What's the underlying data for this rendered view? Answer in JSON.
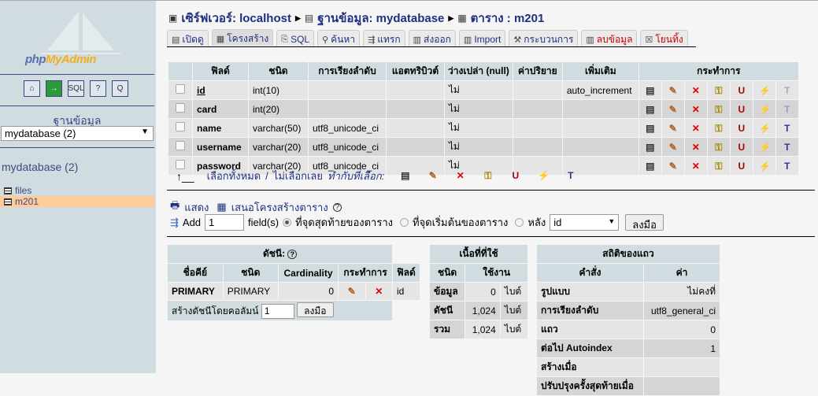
{
  "sidebar": {
    "logo": "phpMyAdmin",
    "quick_icons": [
      "home-icon",
      "exit-icon",
      "sql-query-icon",
      "help-icon",
      "sql-docs-icon"
    ],
    "db_label": "ฐานข้อมูล",
    "db_select": "mydatabase (2)",
    "db_name": "mydatabase (2)",
    "tables": [
      {
        "name": "files",
        "selected": false
      },
      {
        "name": "m201",
        "selected": true
      }
    ]
  },
  "breadcrumb": {
    "server": "เซิร์ฟเวอร์: localhost",
    "database": "ฐานข้อมูล: mydatabase",
    "table": "ตาราง : m201"
  },
  "tabs": [
    {
      "label": "เปิดดู",
      "icon": "▤"
    },
    {
      "label": "โครงสร้าง",
      "icon": "▦",
      "active": true
    },
    {
      "label": "SQL",
      "icon": "⎘"
    },
    {
      "label": "ค้นหา",
      "icon": "⚲"
    },
    {
      "label": "แทรก",
      "icon": "⇶"
    },
    {
      "label": "ส่งออก",
      "icon": "▥"
    },
    {
      "label": "Import",
      "icon": "▥"
    },
    {
      "label": "กระบวนการ",
      "icon": "⚒"
    },
    {
      "label": "ลบข้อมูล",
      "icon": "▥",
      "red": true
    },
    {
      "label": "โยนทิ้ง",
      "icon": "☒",
      "red": true
    }
  ],
  "structure": {
    "headers": [
      "ฟิลด์",
      "ชนิด",
      "การเรียงลำดับ",
      "แอตทริบิวต์",
      "ว่างเปล่า (null)",
      "ค่าปริยาย",
      "เพิ่มเติม",
      "กระทำการ"
    ],
    "rows": [
      {
        "field": "id",
        "type": "int(10)",
        "collation": "",
        "attributes": "",
        "null": "ไม่",
        "default": "",
        "extra": "auto_increment",
        "primary": true
      },
      {
        "field": "card",
        "type": "int(20)",
        "collation": "",
        "attributes": "",
        "null": "ไม่",
        "default": "",
        "extra": ""
      },
      {
        "field": "name",
        "type": "varchar(50)",
        "collation": "utf8_unicode_ci",
        "attributes": "",
        "null": "ไม่",
        "default": "",
        "extra": ""
      },
      {
        "field": "username",
        "type": "varchar(20)",
        "collation": "utf8_unicode_ci",
        "attributes": "",
        "null": "ไม่",
        "default": "",
        "extra": ""
      },
      {
        "field": "password",
        "type": "varchar(20)",
        "collation": "utf8_unicode_ci",
        "attributes": "",
        "null": "ไม่",
        "default": "",
        "extra": ""
      }
    ],
    "check_all": "เลือกทั้งหมด",
    "separator": "/",
    "uncheck_all": "ไม่เลือกเลย",
    "with_selected": "ทำกับที่เลือก:"
  },
  "links": {
    "print": "แสดง",
    "propose": "เสนอโครงสร้างตาราง"
  },
  "add_field": {
    "label": "Add",
    "count": "1",
    "fields": "field(s)",
    "opt_end": "ที่จุดสุดท้ายของตาราง",
    "opt_begin": "ที่จุดเริ่มต้นของตาราง",
    "opt_after": "หลัง",
    "after_value": "id",
    "go": "ลงมือ"
  },
  "indexes": {
    "title": "ดัชนี:",
    "headers": [
      "ชื่อคีย์",
      "ชนิด",
      "Cardinality",
      "กระทำการ",
      "ฟิลด์"
    ],
    "rows": [
      {
        "key": "PRIMARY",
        "type": "PRIMARY",
        "cardinality": "0",
        "field": "id"
      }
    ],
    "create_label": "สร้างดัชนีโดยคอลัมน์",
    "create_value": "1",
    "go": "ลงมือ"
  },
  "space": {
    "title": "เนื้อที่ที่ใช้",
    "headers": [
      "ชนิด",
      "ใช้งาน"
    ],
    "rows": [
      {
        "type": "ข้อมูล",
        "value": "0",
        "unit": "ไบต์"
      },
      {
        "type": "ดัชนี",
        "value": "1,024",
        "unit": "ไบต์"
      },
      {
        "type": "รวม",
        "value": "1,024",
        "unit": "ไบต์"
      }
    ]
  },
  "row_stats": {
    "title": "สถิติของแถว",
    "headers": [
      "คำสั่ง",
      "ค่า"
    ],
    "rows": [
      {
        "stmt": "รูปแบบ",
        "value": "ไม่คงที่"
      },
      {
        "stmt": "การเรียงลำดับ",
        "value": "utf8_general_ci"
      },
      {
        "stmt": "แถว",
        "value": "0"
      },
      {
        "stmt": "ต่อไป Autoindex",
        "value": "1"
      },
      {
        "stmt": "สร้างเมื่อ",
        "value": ""
      },
      {
        "stmt": "ปรับปรุงครั้งสุดท้ายเมื่อ",
        "value": ""
      }
    ]
  },
  "colors": {
    "sidebar": "#d0dce0",
    "header": "#d0dce0",
    "link": "#1f2f80",
    "row_odd": "#e5e5e5",
    "row_even": "#d5d5d5",
    "selected_table": "#ffcc99"
  }
}
